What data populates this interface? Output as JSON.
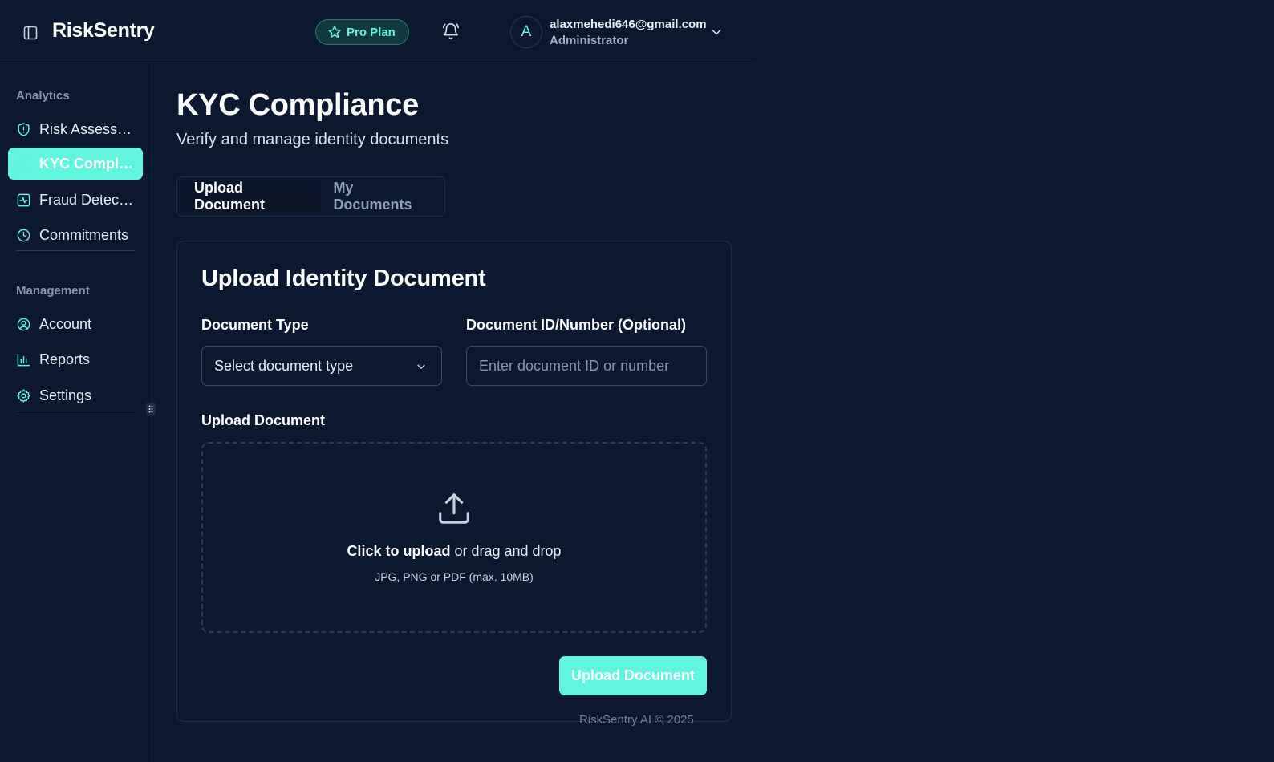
{
  "app": {
    "name": "RiskSentry",
    "plan_label": "Pro Plan",
    "colors": {
      "accent": "#5ff5df",
      "background": "#0b1830",
      "border": "#1f2d47"
    }
  },
  "user": {
    "avatar_initial": "A",
    "email": "alaxmehedi646@gmail.com",
    "role": "Administrator"
  },
  "sidebar": {
    "sections": [
      {
        "label": "Analytics",
        "items": [
          {
            "label": "Risk Assessment",
            "icon": "shield-icon"
          },
          {
            "label": "KYC Compliance",
            "icon": "id-card-icon",
            "active": true
          },
          {
            "label": "Fraud Detection",
            "icon": "activity-icon"
          },
          {
            "label": "Commitments",
            "icon": "clock-icon"
          }
        ]
      },
      {
        "label": "Management",
        "items": [
          {
            "label": "Account",
            "icon": "user-circle-icon"
          },
          {
            "label": "Reports",
            "icon": "bar-chart-icon"
          },
          {
            "label": "Settings",
            "icon": "gear-icon"
          }
        ]
      }
    ]
  },
  "page": {
    "title": "KYC Compliance",
    "subtitle": "Verify and manage identity documents",
    "tabs": [
      {
        "label": "Upload Document",
        "active": true
      },
      {
        "label": "My Documents",
        "active": false
      }
    ]
  },
  "form": {
    "title": "Upload Identity Document",
    "document_type": {
      "label": "Document Type",
      "value": "Select document type"
    },
    "document_id": {
      "label": "Document ID/Number (Optional)",
      "placeholder": "Enter document ID or number"
    },
    "upload": {
      "label": "Upload Document",
      "click_text": "Click to upload",
      "drag_text": " or drag and drop",
      "hint": "JPG, PNG or PDF (max. 10MB)"
    },
    "submit_label": "Upload Document"
  },
  "footer": {
    "text": "RiskSentry AI © 2025"
  }
}
